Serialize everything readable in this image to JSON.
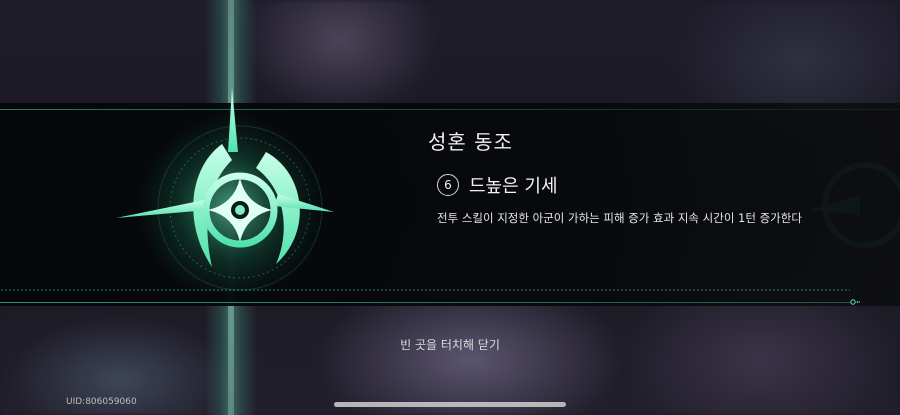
{
  "eidolon": {
    "title": "성혼 동조",
    "rank_number": "6",
    "skill_name": "드높은 기세",
    "description": "전투 스킬이 지정한 아군이 가하는 피해 증가 효과 지속 시간이 1턴 증가한다"
  },
  "close_hint": "빈 곳을 터치해 닫기",
  "uid_text": "UID:806059060",
  "colors": {
    "accent": "#3fe0a8",
    "band": "#050709",
    "text": "#f2f2f2"
  },
  "icons": {
    "emblem": "compass-star-emblem-icon",
    "rank_badge": "circle-number-badge"
  }
}
